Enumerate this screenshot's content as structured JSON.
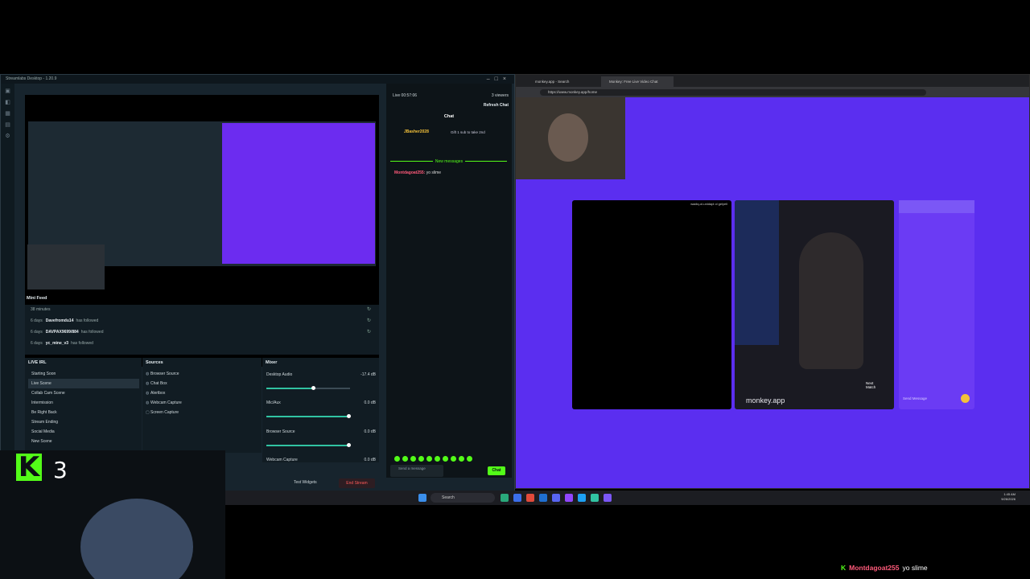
{
  "streamlabs": {
    "title": "Streamlabs Desktop - 1.20.9",
    "minifeed": {
      "title": "Mini Feed",
      "rows": [
        {
          "time": "38 minutes",
          "user": "",
          "action": ""
        },
        {
          "time": "6 days",
          "user": "Davefromdu14",
          "action": "has followed"
        },
        {
          "time": "6 days",
          "user": "DAVPAX9699/884",
          "action": "has followed"
        },
        {
          "time": "6 days",
          "user": "yc_mine_v3",
          "action": "has followed"
        }
      ]
    },
    "scenes": {
      "title": "LIVE IRL",
      "items": [
        "Starting Soon",
        "Live Scene",
        "Collab Cam Scene",
        "Intermission",
        "Be Right Back",
        "Stream Ending",
        "Social Media",
        "New Scene"
      ]
    },
    "sources": {
      "title": "Sources",
      "items": [
        "Browser Source",
        "Chat Box",
        "Alertbox",
        "Webcam Capture",
        "Screen Capture"
      ]
    },
    "mixer": {
      "title": "Mixer",
      "channels": [
        {
          "name": "Desktop Audio",
          "db": "-17.4 dB",
          "level": 0.5
        },
        {
          "name": "Mic/Aux",
          "db": "0.0 dB",
          "level": 1.0
        },
        {
          "name": "Browser Source",
          "db": "0.0 dB",
          "level": 1.0
        },
        {
          "name": "Webcam Capture",
          "db": "0.0 dB",
          "level": 1.0
        }
      ]
    },
    "chat": {
      "live": "Live 00:57:06",
      "viewers": "3 viewers",
      "refresh": "Refresh Chat",
      "header": "Chat",
      "gift_user": "JBasher2028",
      "gift_text": "Gift 1 sub to take 2nd",
      "new_messages": "New messages",
      "msg_user": "Montdagoat255:",
      "msg_text": "yo slime",
      "input_placeholder": "Send a message",
      "send_label": "Chat"
    },
    "test_widgets": "Test Widgets",
    "end_stream": "End Stream"
  },
  "browser": {
    "tabs": [
      "monkey.app - Search",
      "Monkey: Free Live Video Chat"
    ],
    "url": "https://www.monkey.app/home",
    "stranger_tag": "wadiq-ol-unidapl ol gelyell",
    "brand": "monkey.app",
    "next_match": "Next Match",
    "send_message": "Send Message"
  },
  "taskbar": {
    "search": "Search",
    "time": "1:45 AM",
    "date": "9/26/2026"
  },
  "webcam": {
    "count": "3"
  },
  "overlay": {
    "user": "Montdagoat255",
    "message": "yo slime"
  },
  "colors": {
    "kick_green": "#53fc18",
    "monkey_purple": "#5b2ef0",
    "streamlabs_bg": "#17242d"
  }
}
